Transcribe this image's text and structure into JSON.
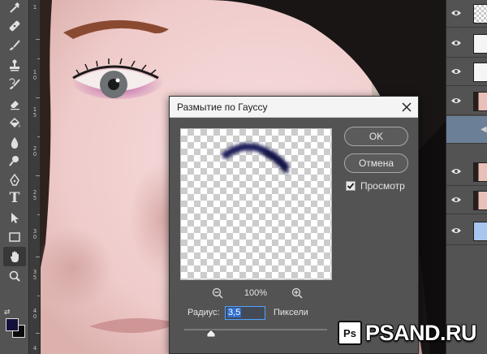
{
  "toolbar": {
    "tools": [
      "eyedropper-icon",
      "healing-brush-icon",
      "brush-icon",
      "clone-stamp-icon",
      "history-brush-icon",
      "eraser-icon",
      "paint-bucket-icon",
      "blur-icon",
      "dodge-icon",
      "pen-icon",
      "type-icon",
      "path-selection-icon",
      "rectangle-icon",
      "hand-icon",
      "zoom-icon"
    ],
    "active_tool": "hand-icon",
    "foreground_color": "#14103c",
    "background_color": "#0b0b0b"
  },
  "ruler": {
    "labels": [
      "1",
      "1\n0",
      "1\n5",
      "2\n0",
      "2\n5",
      "3\n0",
      "3\n5",
      "4\n0",
      "4\n5"
    ]
  },
  "layers": {
    "rows": [
      {
        "thumb": "checker",
        "visible": true
      },
      {
        "thumb": "white",
        "visible": true
      },
      {
        "thumb": "white",
        "visible": true
      },
      {
        "thumb": "face",
        "visible": true
      },
      {
        "thumb": "none",
        "visible": false,
        "selected": true
      },
      {
        "thumb": "face",
        "visible": true
      },
      {
        "thumb": "face",
        "visible": true
      },
      {
        "thumb": "blue",
        "visible": true
      }
    ]
  },
  "dialog": {
    "title": "Размытие по Гауссу",
    "ok_label": "OK",
    "cancel_label": "Отмена",
    "preview_label": "Просмотр",
    "preview_checked": true,
    "zoom_level": "100%",
    "radius_label": "Радиус:",
    "radius_value": "3,5",
    "radius_unit": "Пиксели"
  },
  "watermark": {
    "logo_text": "Ps",
    "site": "PSAND.RU"
  },
  "colors": {
    "accent": "#4da2ff",
    "panel": "#535353",
    "dialog_bg": "#535353",
    "stroke": "#1e1e5a"
  }
}
